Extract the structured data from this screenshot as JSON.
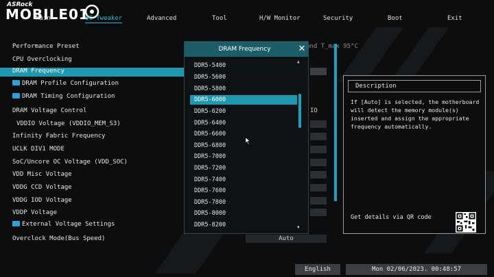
{
  "header": {
    "brand": "ASRock",
    "logo_word": "MOBILE01"
  },
  "tabs": [
    {
      "label": "Main"
    },
    {
      "label": "OC Tweaker"
    },
    {
      "label": "Advanced"
    },
    {
      "label": "Tool"
    },
    {
      "label": "H/W Monitor"
    },
    {
      "label": "Security"
    },
    {
      "label": "Boot"
    },
    {
      "label": "Exit"
    }
  ],
  "menu": {
    "items": [
      {
        "label": "Performance Preset"
      },
      {
        "label": "CPU Overclocking"
      },
      {
        "label": "DRAM Frequency"
      },
      {
        "label": "DRAM Profile Configuration"
      },
      {
        "label": "DRAM Timing Configuration"
      },
      {
        "label": "DRAM Voltage Control"
      },
      {
        "label": "VDDIO Voltage (VDDIO_MEM_S3)"
      },
      {
        "label": "Infinity Fabric Frequency"
      },
      {
        "label": "UCLK DIV1 MODE"
      },
      {
        "label": "SoC/Uncore OC Voltage (VDD_SOC)"
      },
      {
        "label": "VDD Misc Voltage"
      },
      {
        "label": "VDDG CCD Voltage"
      },
      {
        "label": "VDDG IOD Voltage"
      },
      {
        "label": "VDDP Voltage"
      },
      {
        "label": "External Voltage Settings"
      },
      {
        "label": "Overclock Mode(Bus Speed)"
      }
    ]
  },
  "values": {
    "partial_top": "and T_max 95°C",
    "partial_io": "IO",
    "overclock_mode": "Auto"
  },
  "dropdown": {
    "title": "DRAM Frequency",
    "close_icon": "close-icon",
    "options": [
      "DDR5-5400",
      "DDR5-5600",
      "DDR5-5800",
      "DDR5-6000",
      "DDR5-6200",
      "DDR5-6400",
      "DDR5-6600",
      "DDR5-6800",
      "DDR5-7000",
      "DDR5-7200",
      "DDR5-7400",
      "DDR5-7600",
      "DDR5-7800",
      "DDR5-8000",
      "DDR5-8200"
    ],
    "selected": "DDR5-6000"
  },
  "description": {
    "title": "Description",
    "text": "If [Auto] is selected, the motherboard will detect the memory module(s) inserted and assign the appropriate frequency automatically.",
    "qr_text": "Get details via QR code"
  },
  "footer": {
    "language": "English",
    "datetime": "Mon 02/06/2023. 00:48:57"
  },
  "colors": {
    "accent": "#1e98ae",
    "background": "#0b0d0f",
    "dropdown_header": "#1b5d68"
  }
}
